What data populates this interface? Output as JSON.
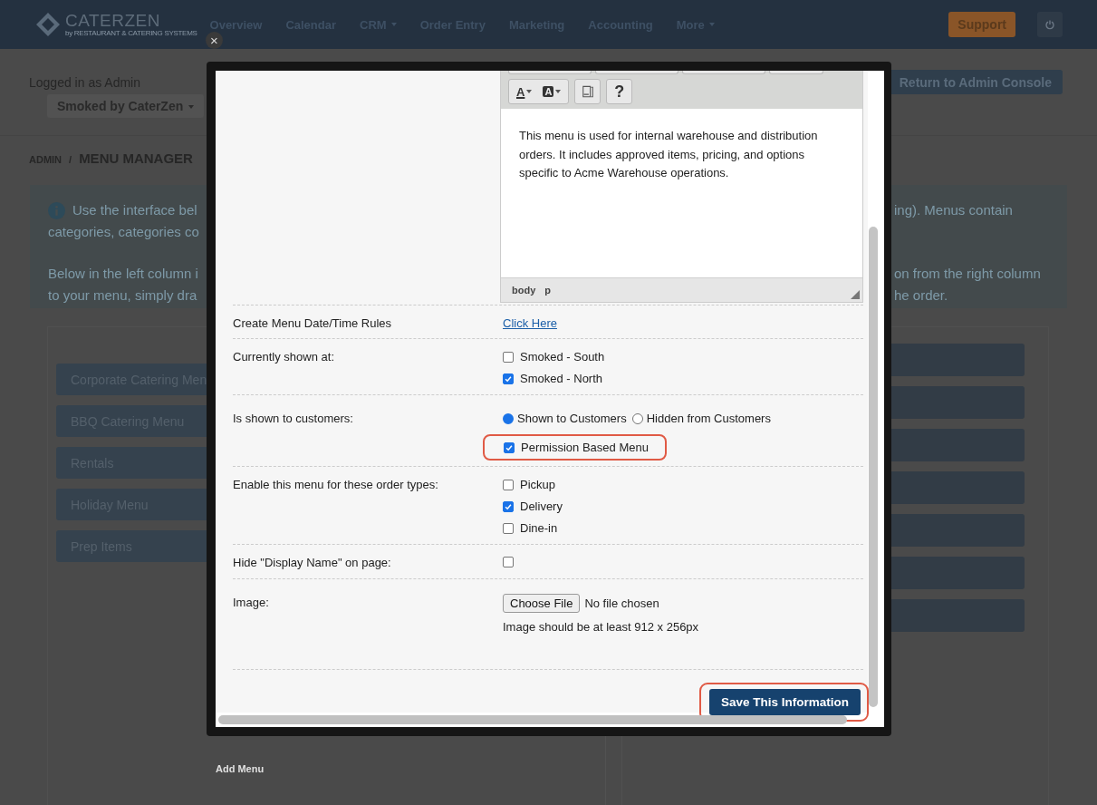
{
  "nav": {
    "logo": "CATERZEN",
    "tagline": "by RESTAURANT & CATERING SYSTEMS",
    "items": [
      {
        "label": "Overview",
        "dropdown": false
      },
      {
        "label": "Calendar",
        "dropdown": false
      },
      {
        "label": "CRM",
        "dropdown": true
      },
      {
        "label": "Order Entry",
        "dropdown": false
      },
      {
        "label": "Marketing",
        "dropdown": false
      },
      {
        "label": "Accounting",
        "dropdown": false
      },
      {
        "label": "More",
        "dropdown": true
      }
    ],
    "support": "Support"
  },
  "header": {
    "logged_in": "Logged in as Admin",
    "account": "Smoked by CaterZen",
    "return_button": "Return to Admin Console"
  },
  "breadcrumb": {
    "parent": "ADMIN",
    "separator": "/",
    "current": "MENU MANAGER"
  },
  "info": {
    "lines": [
      {
        "left": "Use the interface bel",
        "right": "ing). Menus contain"
      },
      {
        "left": "categories, categories co"
      },
      {
        "left": "Below in the left column i",
        "right": "on from the right column"
      },
      {
        "left": "to your menu, simply dra",
        "right": "he order."
      }
    ]
  },
  "menus": [
    "Corporate Catering Men",
    "BBQ Catering Menu",
    "Rentals",
    "Holiday Menu",
    "Prep Items"
  ],
  "add_menu": "Add Menu",
  "modal": {
    "close": "×",
    "editor": {
      "toolbar": [
        {
          "kind": "forecolor",
          "glyph": "A"
        },
        {
          "kind": "backcolor",
          "glyph": "A"
        },
        {
          "kind": "code"
        },
        {
          "kind": "help",
          "glyph": "?"
        }
      ],
      "text": "This menu is used for internal warehouse and distribution orders. It includes approved items, pricing, and options specific to Acme Warehouse operations.",
      "path": [
        "body",
        "p"
      ]
    },
    "rows": [
      {
        "kind": "link",
        "label": "Create Menu Date/Time Rules",
        "link": "Click Here"
      },
      {
        "kind": "checkboxes",
        "label": "Currently shown at:",
        "options": [
          {
            "label": "Smoked - South",
            "checked": false
          },
          {
            "label": "Smoked - North",
            "checked": true
          }
        ]
      },
      {
        "kind": "visibility",
        "label": "Is shown to customers:",
        "options": [
          {
            "label": "Shown to Customers",
            "selected": true
          },
          {
            "label": "Hidden from Customers",
            "selected": false
          }
        ],
        "permission": {
          "label": "Permission Based Menu",
          "checked": true,
          "highlighted": true
        }
      },
      {
        "kind": "checkboxes",
        "label": "Enable this menu for these order types:",
        "options": [
          {
            "label": "Pickup",
            "checked": false
          },
          {
            "label": "Delivery",
            "checked": true
          },
          {
            "label": "Dine-in",
            "checked": false
          }
        ]
      },
      {
        "kind": "checkbox",
        "label": "Hide \"Display Name\" on page:",
        "checked": false
      },
      {
        "kind": "file",
        "label": "Image:",
        "button": "Choose File",
        "status": "No file chosen",
        "hint": "Image should be at least 912 x 256px"
      }
    ],
    "save": {
      "label": "Save This Information",
      "highlighted": true
    }
  }
}
